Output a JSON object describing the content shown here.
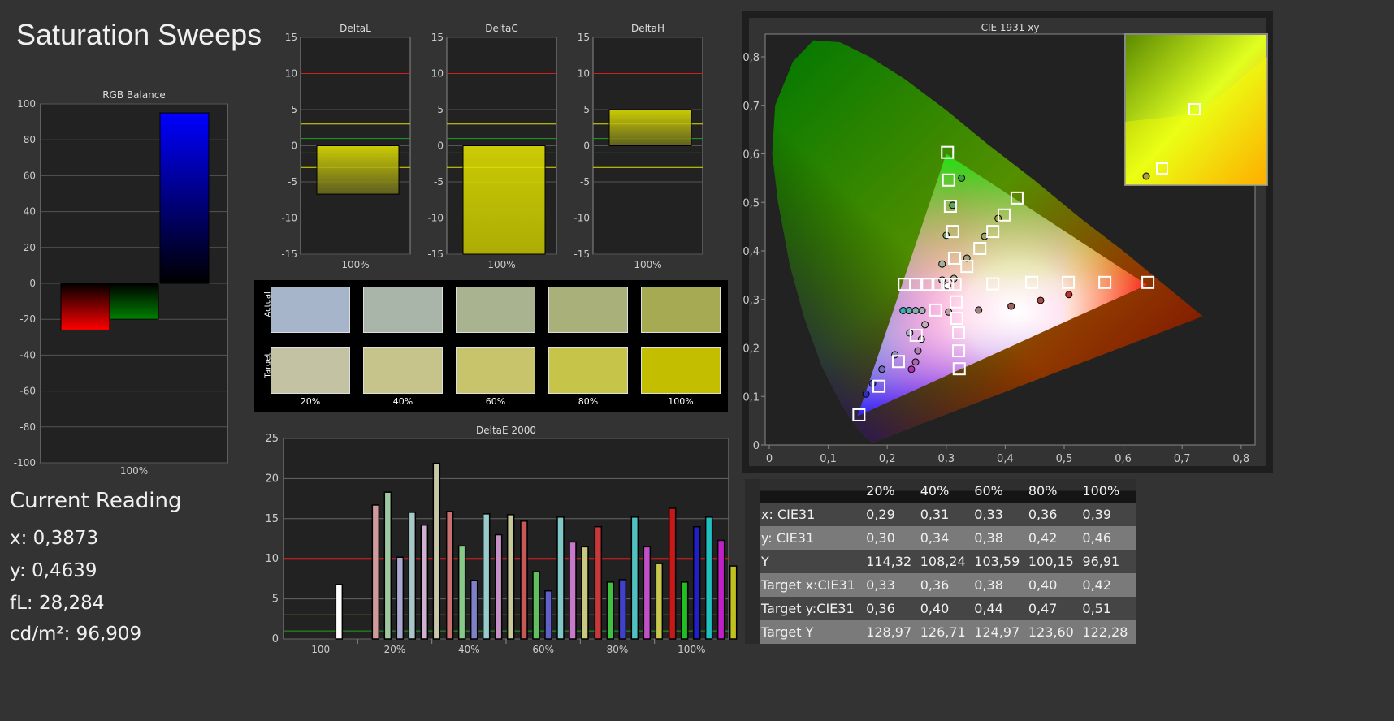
{
  "title": "Saturation Sweeps",
  "rgb_balance": {
    "title": "RGB Balance",
    "category": "100%",
    "ylim": [
      -100,
      100
    ],
    "ticks": [
      100,
      80,
      60,
      40,
      20,
      0,
      -20,
      -40,
      -60,
      -80,
      -100
    ],
    "values": [
      {
        "name": "R",
        "value": -26,
        "color": "#ff0000"
      },
      {
        "name": "G",
        "value": -20,
        "color": "#008000"
      },
      {
        "name": "B",
        "value": 95,
        "color": "#0000ff"
      }
    ]
  },
  "delta_charts": [
    {
      "title": "DeltaL",
      "category": "100%",
      "value": -6.7
    },
    {
      "title": "DeltaC",
      "category": "100%",
      "value": -15
    },
    {
      "title": "DeltaH",
      "category": "100%",
      "value": 5
    }
  ],
  "delta_ticks": [
    15,
    10,
    5,
    0,
    -5,
    -10,
    -15
  ],
  "swatches": {
    "actual_label": "Actual",
    "target_label": "Target",
    "labels": [
      "20%",
      "40%",
      "60%",
      "80%",
      "100%"
    ],
    "actual": [
      "#a7b5cb",
      "#a9b5a8",
      "#aab38f",
      "#a9b07a",
      "#a6aa52"
    ],
    "target": [
      "#c3c3a4",
      "#c6c48a",
      "#c7c46c",
      "#c7c44a",
      "#c3bf00"
    ]
  },
  "current_reading": {
    "title": "Current Reading",
    "lines": [
      "x: 0,3873",
      "y: 0,4639",
      "fL: 28,284",
      "cd/m²: 96,909"
    ]
  },
  "chart_data": [
    {
      "type": "bar",
      "title": "DeltaE 2000",
      "ylim": [
        0,
        25
      ],
      "ticks": [
        25,
        20,
        15,
        10,
        5,
        0
      ],
      "categories": [
        "100",
        "20%",
        "40%",
        "60%",
        "80%",
        "100%"
      ],
      "thresholds": [
        {
          "value": 10,
          "color": "#e02020"
        },
        {
          "value": 3,
          "color": "#e0e020"
        },
        {
          "value": 1,
          "color": "#20a020"
        }
      ],
      "groups": [
        [
          {
            "color": "#ffffff",
            "value": 6.8
          }
        ],
        [
          {
            "color": "#d09a9a",
            "value": 16.7
          },
          {
            "color": "#a0c8a0",
            "value": 18.3
          },
          {
            "color": "#a8a8d0",
            "value": 10.2
          },
          {
            "color": "#a8c8c8",
            "value": 15.8
          },
          {
            "color": "#d0b0d0",
            "value": 14.2
          },
          {
            "color": "#c8c8a8",
            "value": 21.9
          }
        ],
        [
          {
            "color": "#c87070",
            "value": 15.9
          },
          {
            "color": "#88c888",
            "value": 11.6
          },
          {
            "color": "#8080c8",
            "value": 7.3
          },
          {
            "color": "#98cccc",
            "value": 15.6
          },
          {
            "color": "#c890c8",
            "value": 13.0
          },
          {
            "color": "#c8c898",
            "value": 15.5
          }
        ],
        [
          {
            "color": "#c85858",
            "value": 14.7
          },
          {
            "color": "#60c060",
            "value": 8.4
          },
          {
            "color": "#6060c8",
            "value": 6.0
          },
          {
            "color": "#80c8c8",
            "value": 15.2
          },
          {
            "color": "#c878c8",
            "value": 12.1
          },
          {
            "color": "#c8c880",
            "value": 11.5
          }
        ],
        [
          {
            "color": "#c83838",
            "value": 14.0
          },
          {
            "color": "#40c040",
            "value": 7.1
          },
          {
            "color": "#4040c8",
            "value": 7.4
          },
          {
            "color": "#50c0c0",
            "value": 15.2
          },
          {
            "color": "#c050c8",
            "value": 11.5
          },
          {
            "color": "#c8c850",
            "value": 9.4
          }
        ],
        [
          {
            "color": "#c81818",
            "value": 16.3
          },
          {
            "color": "#20c020",
            "value": 7.1
          },
          {
            "color": "#2020c8",
            "value": 14.0
          },
          {
            "color": "#20c0c0",
            "value": 15.2
          },
          {
            "color": "#c020c8",
            "value": 12.3
          },
          {
            "color": "#c0c020",
            "value": 9.1
          }
        ]
      ]
    },
    {
      "type": "scatter",
      "title": "CIE 1931 xy",
      "xlim": [
        0,
        0.83
      ],
      "ylim": [
        0,
        0.85
      ],
      "xticks": [
        "0",
        "0,1",
        "0,2",
        "0,3",
        "0,4",
        "0,5",
        "0,6",
        "0,7",
        "0,8"
      ],
      "yticks": [
        "0",
        "0,1",
        "0,2",
        "0,3",
        "0,4",
        "0,5",
        "0,6",
        "0,7",
        "0,8"
      ],
      "gamut": [
        [
          0.64,
          0.33
        ],
        [
          0.3,
          0.6
        ],
        [
          0.15,
          0.06
        ]
      ],
      "targets": [
        [
          0.642,
          0.335
        ],
        [
          0.569,
          0.335
        ],
        [
          0.507,
          0.335
        ],
        [
          0.445,
          0.335
        ],
        [
          0.379,
          0.332
        ],
        [
          0.302,
          0.603
        ],
        [
          0.304,
          0.546
        ],
        [
          0.307,
          0.492
        ],
        [
          0.311,
          0.44
        ],
        [
          0.314,
          0.385
        ],
        [
          0.152,
          0.062
        ],
        [
          0.186,
          0.121
        ],
        [
          0.219,
          0.172
        ],
        [
          0.249,
          0.226
        ],
        [
          0.282,
          0.278
        ],
        [
          0.229,
          0.331
        ],
        [
          0.248,
          0.331
        ],
        [
          0.269,
          0.331
        ],
        [
          0.286,
          0.331
        ],
        [
          0.302,
          0.331
        ],
        [
          0.322,
          0.157
        ],
        [
          0.321,
          0.194
        ],
        [
          0.321,
          0.231
        ],
        [
          0.318,
          0.261
        ],
        [
          0.317,
          0.295
        ],
        [
          0.42,
          0.509
        ],
        [
          0.398,
          0.474
        ],
        [
          0.379,
          0.44
        ],
        [
          0.357,
          0.405
        ],
        [
          0.335,
          0.368
        ],
        [
          0.315,
          0.331
        ]
      ],
      "measured": [
        {
          "x": 0.508,
          "y": 0.31,
          "color": "#c03030"
        },
        {
          "x": 0.46,
          "y": 0.298,
          "color": "#b04848"
        },
        {
          "x": 0.41,
          "y": 0.286,
          "color": "#a06060"
        },
        {
          "x": 0.355,
          "y": 0.278,
          "color": "#a08080"
        },
        {
          "x": 0.304,
          "y": 0.274,
          "color": "#b0a0a0"
        },
        {
          "x": 0.326,
          "y": 0.55,
          "color": "#40a040"
        },
        {
          "x": 0.311,
          "y": 0.494,
          "color": "#60a060"
        },
        {
          "x": 0.3,
          "y": 0.432,
          "color": "#80a080"
        },
        {
          "x": 0.293,
          "y": 0.373,
          "color": "#a0b0a0"
        },
        {
          "x": 0.293,
          "y": 0.34,
          "color": "#c0c0c0"
        },
        {
          "x": 0.164,
          "y": 0.105,
          "color": "#3030b0"
        },
        {
          "x": 0.175,
          "y": 0.127,
          "color": "#5050b0"
        },
        {
          "x": 0.191,
          "y": 0.156,
          "color": "#7070b0"
        },
        {
          "x": 0.213,
          "y": 0.186,
          "color": "#9090c0"
        },
        {
          "x": 0.238,
          "y": 0.231,
          "color": "#a8a8c8"
        },
        {
          "x": 0.227,
          "y": 0.277,
          "color": "#30b0b0"
        },
        {
          "x": 0.237,
          "y": 0.277,
          "color": "#60b0b0"
        },
        {
          "x": 0.248,
          "y": 0.277,
          "color": "#80b0b0"
        },
        {
          "x": 0.259,
          "y": 0.277,
          "color": "#a0b8b8"
        },
        {
          "x": 0.241,
          "y": 0.156,
          "color": "#b030b0"
        },
        {
          "x": 0.248,
          "y": 0.171,
          "color": "#b060b0"
        },
        {
          "x": 0.252,
          "y": 0.194,
          "color": "#b080b0"
        },
        {
          "x": 0.258,
          "y": 0.218,
          "color": "#b0a0b0"
        },
        {
          "x": 0.264,
          "y": 0.248,
          "color": "#c0b0c0"
        },
        {
          "x": 0.388,
          "y": 0.467,
          "color": "#a0a040"
        },
        {
          "x": 0.365,
          "y": 0.43,
          "color": "#a0a060"
        },
        {
          "x": 0.335,
          "y": 0.385,
          "color": "#a0a080"
        },
        {
          "x": 0.313,
          "y": 0.343,
          "color": "#b0b0a0"
        },
        {
          "x": 0.302,
          "y": 0.328,
          "color": "#ffffff"
        }
      ]
    }
  ],
  "table": {
    "headers": [
      "",
      "20%",
      "40%",
      "60%",
      "80%",
      "100%"
    ],
    "rows": [
      {
        "label": "x: CIE31",
        "values": [
          "0,29",
          "0,31",
          "0,33",
          "0,36",
          "0,39"
        ]
      },
      {
        "label": "y: CIE31",
        "values": [
          "0,30",
          "0,34",
          "0,38",
          "0,42",
          "0,46"
        ]
      },
      {
        "label": "Y",
        "values": [
          "114,32",
          "108,24",
          "103,59",
          "100,15",
          "96,91"
        ]
      },
      {
        "label": "Target x:CIE31",
        "values": [
          "0,33",
          "0,36",
          "0,38",
          "0,40",
          "0,42"
        ]
      },
      {
        "label": "Target y:CIE31",
        "values": [
          "0,36",
          "0,40",
          "0,44",
          "0,47",
          "0,51"
        ]
      },
      {
        "label": "Target Y",
        "values": [
          "128,97",
          "126,71",
          "124,97",
          "123,60",
          "122,28"
        ]
      }
    ]
  }
}
